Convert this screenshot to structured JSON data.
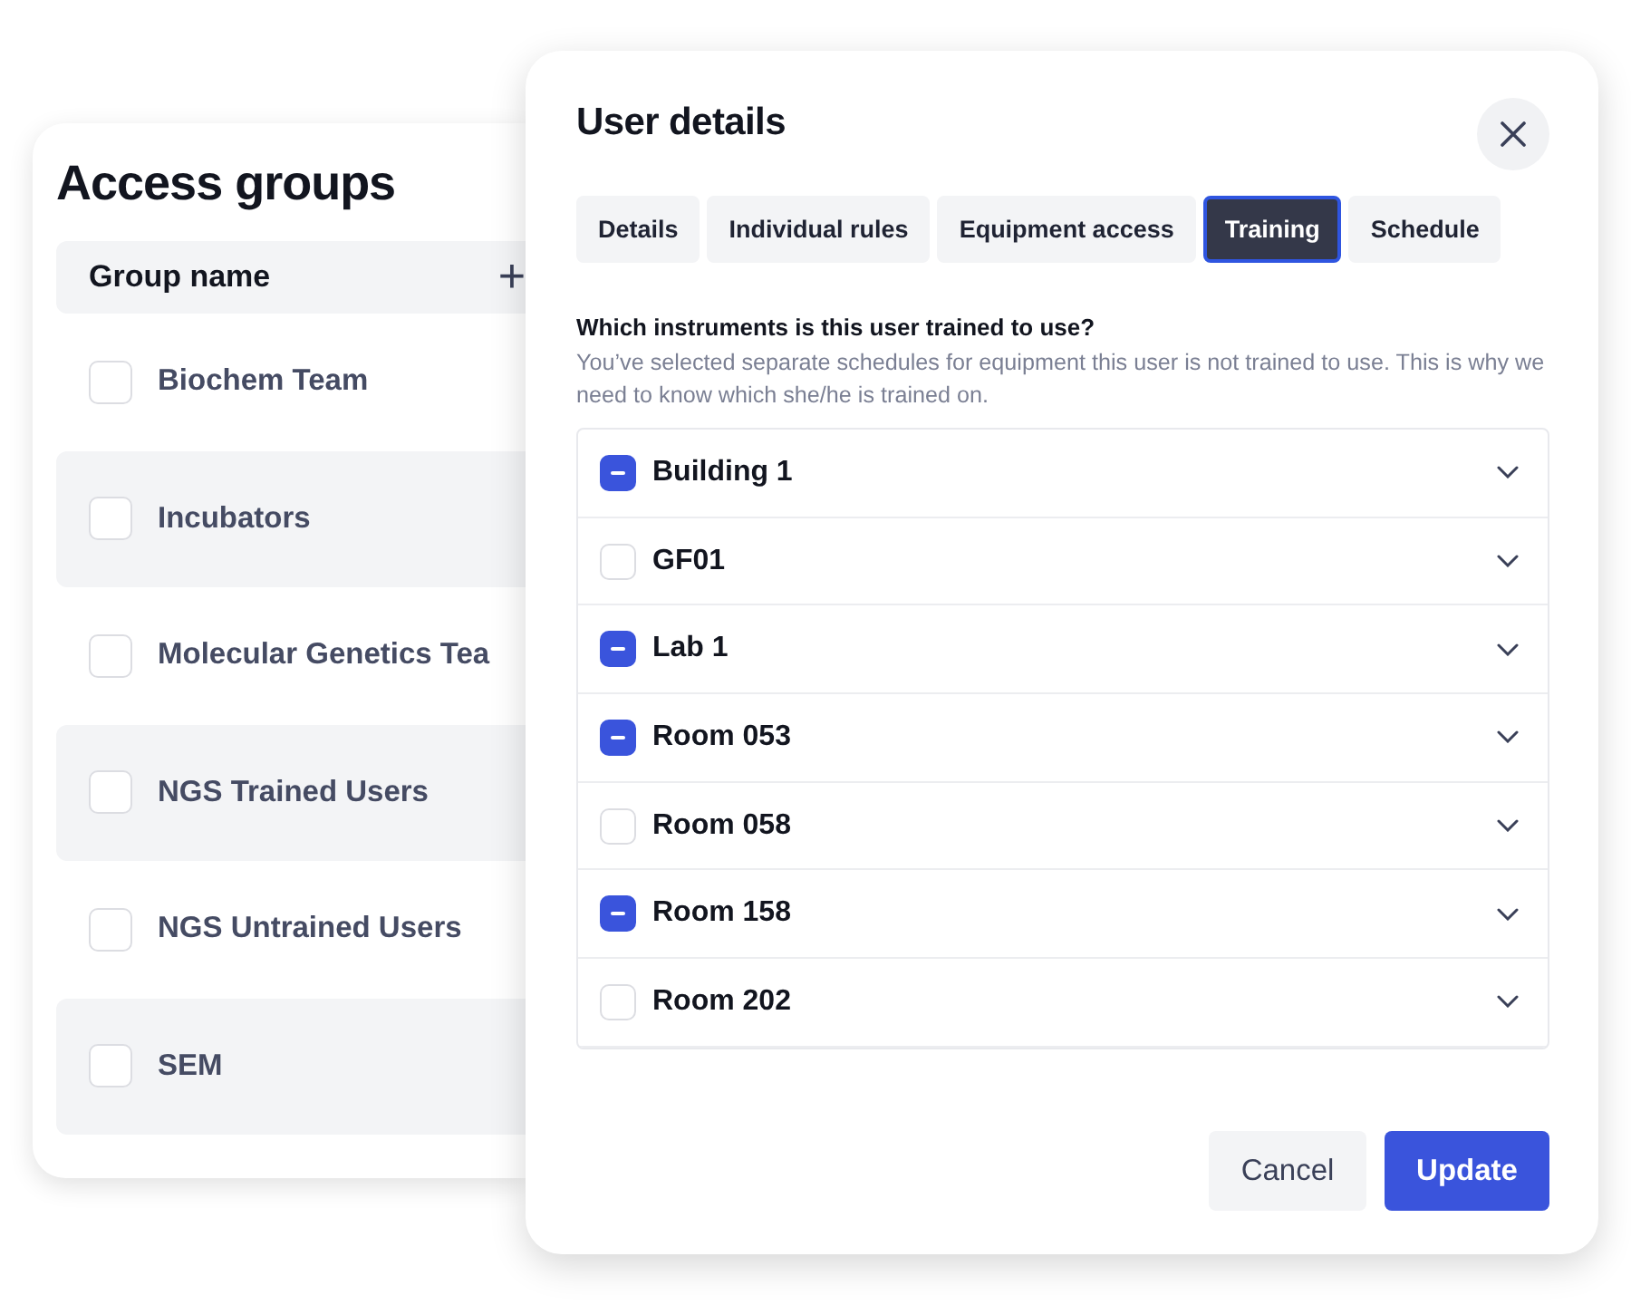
{
  "access_groups": {
    "title": "Access groups",
    "column_header": "Group name",
    "add_icon": "+",
    "rows": [
      {
        "name": "Biochem Team",
        "checked": false
      },
      {
        "name": "Incubators",
        "checked": false
      },
      {
        "name": "Molecular Genetics Tea",
        "checked": false
      },
      {
        "name": "NGS Trained Users",
        "checked": false
      },
      {
        "name": "NGS Untrained Users",
        "checked": false
      },
      {
        "name": "SEM",
        "checked": false
      }
    ]
  },
  "dialog": {
    "title": "User details",
    "tabs": [
      {
        "label": "Details",
        "selected": false
      },
      {
        "label": "Individual rules",
        "selected": false
      },
      {
        "label": "Equipment access",
        "selected": false
      },
      {
        "label": "Training",
        "selected": true
      },
      {
        "label": "Schedule",
        "selected": false
      }
    ],
    "question": "Which instruments is this user trained to use?",
    "description": "You’ve selected separate schedules for equipment this user is not trained to use. This is why we need to know which she/he is trained on.",
    "locations": [
      {
        "name": "Building 1",
        "partial": true
      },
      {
        "name": "GF01",
        "partial": false
      },
      {
        "name": "Lab 1",
        "partial": true
      },
      {
        "name": "Room 053",
        "partial": true
      },
      {
        "name": "Room 058",
        "partial": false
      },
      {
        "name": "Room 158",
        "partial": true
      },
      {
        "name": "Room 202",
        "partial": false
      }
    ],
    "buttons": [
      {
        "label": "Cancel",
        "kind": "secondary"
      },
      {
        "label": "Update",
        "kind": "primary"
      }
    ]
  }
}
